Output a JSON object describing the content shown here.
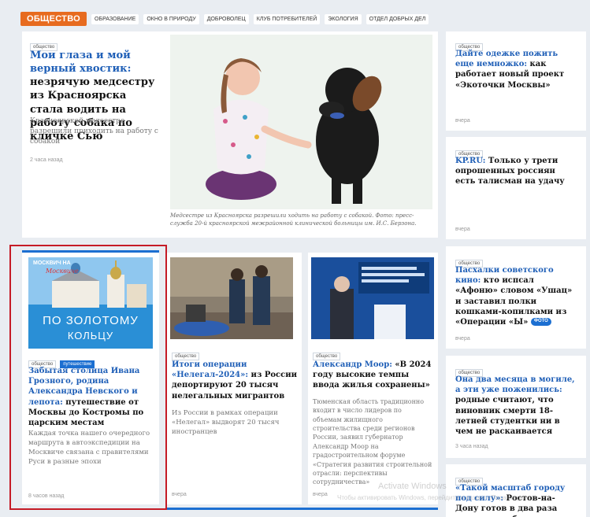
{
  "nav": {
    "section": "ОБЩЕСТВО",
    "links": [
      "ОБРАЗОВАНИЕ",
      "ОКНО В ПРИРОДУ",
      "ДОБРОВОЛЕЦ",
      "КЛУБ ПОТРЕБИТЕЛЕЙ",
      "ЭКОЛОГИЯ",
      "ОТДЕЛ ДОБРЫХ ДЕЛ"
    ]
  },
  "feature": {
    "tag": "общество",
    "headline_lead": "Мои глаза и мой верный хвостик:",
    "headline_rest": " незрячую медсестру из Красноярска стала водить на работу собака по кличке Сью",
    "lede": "Красноярской медсестре разрешили приходить на работу с собакой",
    "time": "2 часа назад",
    "caption": "Медсестре из Красноярска разрешили ходить на работу с собакой. Фото: пресс-служба 20-й красноярской межрайонной клинической больницы им. И.С. Берзона."
  },
  "right": [
    {
      "tag": "общество",
      "headline_lead": "Дайте одежке пожить еще немножко:",
      "headline_rest": " как работает новый проект «Экоточки Москвы»",
      "time": "вчера"
    },
    {
      "tag": "общество",
      "headline_lead": "KP.RU:",
      "headline_rest": " Только у трети опрошенных россиян есть талисман на удачу",
      "time": "вчера"
    },
    {
      "tag": "общество",
      "headline_lead": "Пасхалки советского кино:",
      "headline_rest": " кто испсал «Афоню» словом «Ушац» и заставил полки кошками-копилками из «Операции «Ы»",
      "badge": "ФОТО",
      "time": "вчера"
    },
    {
      "tag": "общество",
      "headline_lead": "Она два месяца в могиле, а эти уже поженились:",
      "headline_rest": " родные считают, что виновник смерти 18-летней студентки ни в чем не раскаивается",
      "time": "3 часа назад"
    },
    {
      "tag": "общество",
      "headline_lead": "«Такой масштаб городу под силу»:",
      "headline_rest": " Ростов-на-Дону готов в два раза увеличить объем"
    }
  ],
  "card_tour": {
    "promo_small": "МОСКВИЧ НА",
    "promo_brand": "Москвиче",
    "promo_line1": "ПО ЗОЛОТОМУ",
    "promo_line2": "КОЛЬЦУ",
    "tag": "общество",
    "tag2": "ПУТЕШЕСТВИЕ",
    "headline_lead": "Забытая столица Ивана Грозного, родина Александра Невского и лепота:",
    "headline_rest": " путешествие от Москвы до Костромы по царским местам",
    "lede": "Каждая точка нашего очередного маршрута в автоэкспедиции на Москвиче связана с правителями Руси в разные эпохи",
    "time": "8 часов назад"
  },
  "card_migrants": {
    "tag": "общество",
    "headline_lead": "Итоги операции «Нелегал-2024»:",
    "headline_rest": " из России депортируют 20 тысяч нелегальных мигрантов",
    "lede": "Из России в рамках операции «Нелегал» выдворят 20 тысяч иностранцев",
    "time": "вчера"
  },
  "card_moor": {
    "tag": "общество",
    "headline_lead": "Александр Моор:",
    "headline_rest": " «В 2024 году высокие темпы ввода жилья сохранены»",
    "lede": "Тюменская область традиционно входит в число лидеров по объемам жилищного строительства среди регионов России, заявил губернатор Александр Моор на градостроительном форуме «Стратегия развития строительной отрасли: перспективы сотрудничества»",
    "time": "вчера"
  },
  "watermark": {
    "line1": "Activate Windows",
    "line2": "Чтобы активировать Windows, перейдите в раздел «Параметры»."
  }
}
